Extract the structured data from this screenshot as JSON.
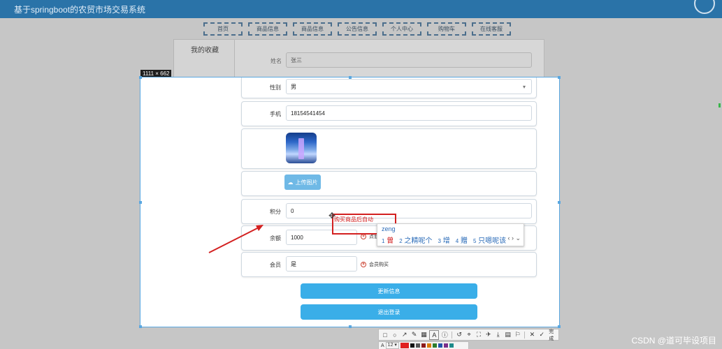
{
  "app": {
    "title": "基于springboot的农贸市场交易系统"
  },
  "nav": {
    "items": [
      "首页",
      "商品信息",
      "商品信息",
      "公告信息",
      "个人中心",
      "购物车",
      "在线客服"
    ]
  },
  "sidebar": {
    "title": "我的收藏"
  },
  "selection": {
    "size_label": "1111 × 662"
  },
  "form": {
    "name_label": "姓名",
    "name_value": "张三",
    "gender_label": "性别",
    "gender_value": "男",
    "phone_label": "手机",
    "phone_value": "18154541454",
    "upload_label": "上传图片",
    "points_label": "积分",
    "points_value": "0",
    "balance_label": "余额",
    "balance_value": "1000",
    "balance_hint": "点我",
    "member_label": "会员",
    "member_value": "是",
    "member_hint": "会员购买",
    "update_btn": "更新信息",
    "logout_btn": "退出登录"
  },
  "annotation": {
    "text": "购买商品后自动"
  },
  "ime": {
    "composition": "zeng",
    "candidates": [
      {
        "n": "1",
        "w": "曾"
      },
      {
        "n": "2",
        "w": "之精呢个"
      },
      {
        "n": "3",
        "w": "增"
      },
      {
        "n": "4",
        "w": "赠"
      },
      {
        "n": "5",
        "w": "只嗯呢该"
      }
    ],
    "nav": "‹ › ⌄"
  },
  "toolbar": {
    "tools": [
      "rect-icon",
      "ellipse-icon",
      "arrow-icon",
      "pen-icon",
      "mosaic-icon",
      "text-icon",
      "number-icon",
      "undo-icon",
      "pin-icon",
      "crop-icon",
      "download-icon",
      "copy-icon",
      "save-icon",
      "close-icon",
      "check-icon"
    ],
    "done_label": "完成",
    "font_size": "12",
    "swatches": [
      "#e02020",
      "#111111",
      "#555555",
      "#8b1a1a",
      "#d97a00",
      "#2d7d2d",
      "#2255aa",
      "#7a2e8a",
      "#1d8a8a"
    ]
  },
  "watermark": "CSDN @道可毕设项目"
}
